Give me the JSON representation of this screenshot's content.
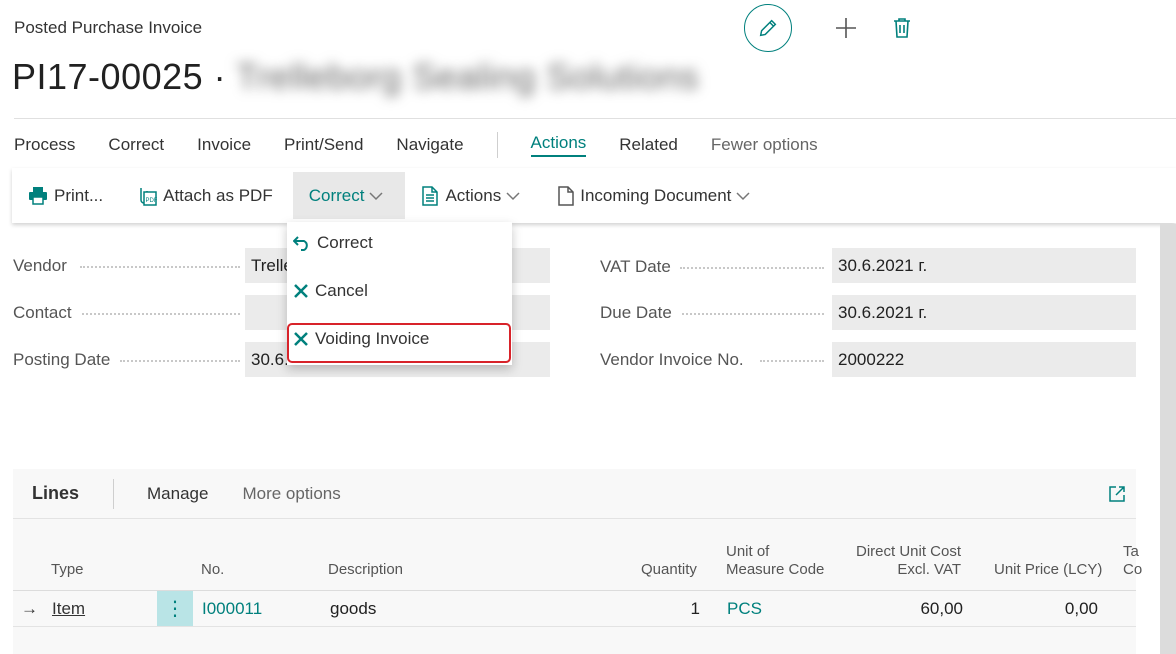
{
  "header": {
    "page_type": "Posted Purchase Invoice",
    "document_no": "PI17-00025",
    "separator": "·",
    "vendor_name": "Trelleborg Sealing Solutions",
    "edit_icon": "pencil-icon",
    "new_icon": "plus-icon",
    "delete_icon": "trash-icon"
  },
  "menu": {
    "items": [
      "Process",
      "Correct",
      "Invoice",
      "Print/Send",
      "Navigate"
    ],
    "tabs": [
      "Actions",
      "Related",
      "Fewer options"
    ],
    "active_tab": "Actions"
  },
  "action_bar": {
    "print_label": "Print...",
    "attach_label": "Attach as PDF",
    "correct_label": "Correct",
    "actions_label": "Actions",
    "incoming_label": "Incoming Document"
  },
  "dropdown": {
    "items": [
      {
        "label": "Correct",
        "icon": "undo-icon"
      },
      {
        "label": "Cancel",
        "icon": "x-icon"
      },
      {
        "label": "Voiding Invoice",
        "icon": "x-icon"
      }
    ],
    "highlighted": "Voiding Invoice"
  },
  "general": {
    "vendor_label": "Vendor",
    "vendor_value": "Trelle",
    "contact_label": "Contact",
    "contact_value": "",
    "posting_date_label": "Posting Date",
    "posting_date_value": "30.6.2021 г.",
    "vat_date_label": "VAT Date",
    "vat_date_value": "30.6.2021 г.",
    "due_date_label": "Due Date",
    "due_date_value": "30.6.2021 г.",
    "vendor_invoice_label": "Vendor Invoice No.",
    "vendor_invoice_value": "2000222"
  },
  "lines": {
    "title": "Lines",
    "manage": "Manage",
    "more": "More options",
    "columns": {
      "type": "Type",
      "no": "No.",
      "description": "Description",
      "quantity": "Quantity",
      "uom_1": "Unit of",
      "uom_2": "Measure Code",
      "cost_1": "Direct Unit Cost",
      "cost_2": "Excl. VAT",
      "price": "Unit Price (LCY)",
      "tax_1": "Ta",
      "tax_2": "Co"
    },
    "rows": [
      {
        "arrow": "→",
        "type": "Item",
        "menu": "⋮",
        "no": "I000011",
        "description": "goods",
        "quantity": "1",
        "uom": "PCS",
        "cost": "60,00",
        "price": "0,00"
      }
    ]
  },
  "colors": {
    "accent": "#00807d",
    "highlight_border": "#d8232a",
    "field_bg": "#ebebeb"
  }
}
